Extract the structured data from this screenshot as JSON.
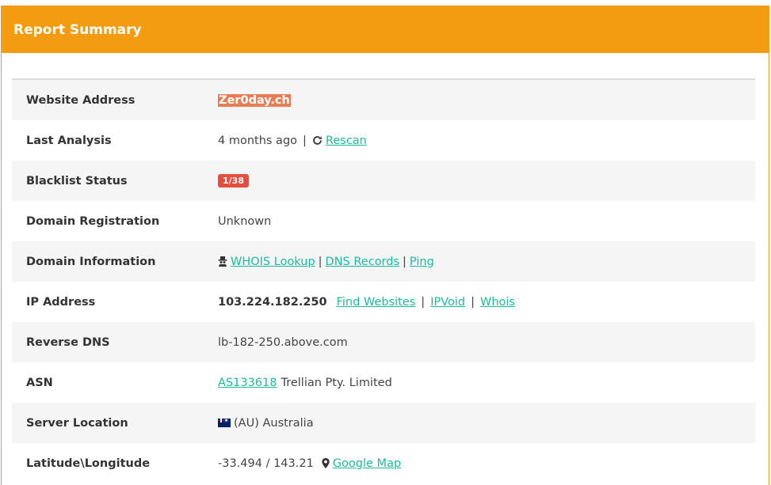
{
  "panel": {
    "title": "Report Summary"
  },
  "rows": {
    "website": {
      "label": "Website Address",
      "value": "Zer0day.ch"
    },
    "last_analysis": {
      "label": "Last Analysis",
      "value": "4 months ago",
      "separator": "|",
      "rescan": "Rescan"
    },
    "blacklist": {
      "label": "Blacklist Status",
      "badge": "1/38"
    },
    "registration": {
      "label": "Domain Registration",
      "value": "Unknown"
    },
    "domain_info": {
      "label": "Domain Information",
      "whois": "WHOIS Lookup",
      "dns": "DNS Records",
      "ping": "Ping",
      "separator": "|"
    },
    "ip": {
      "label": "IP Address",
      "value": "103.224.182.250",
      "find_websites": "Find Websites",
      "ipvoid": "IPVoid",
      "whois": "Whois",
      "separator": "|"
    },
    "reverse_dns": {
      "label": "Reverse DNS",
      "value": "lb-182-250.above.com"
    },
    "asn": {
      "label": "ASN",
      "asn": "AS133618",
      "org": "Trellian Pty. Limited"
    },
    "location": {
      "label": "Server Location",
      "value": "(AU) Australia"
    },
    "latlong": {
      "label": "Latitude\\Longitude",
      "value": "-33.494 / 143.21",
      "map": "Google Map"
    }
  },
  "colors": {
    "header": "#f39c12",
    "link": "#18bc9c",
    "badge": "#e74c3c",
    "highlight": "#e87d54"
  },
  "icons": [
    "refresh-icon",
    "spy-icon",
    "au-flag-icon",
    "map-marker-icon"
  ]
}
